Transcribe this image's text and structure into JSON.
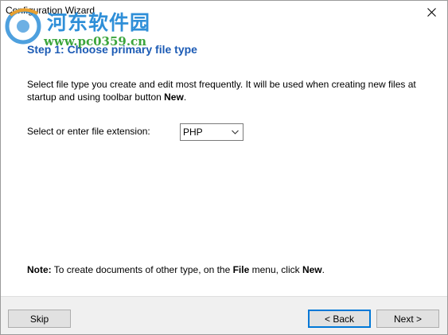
{
  "window": {
    "title": "Configuration Wizard"
  },
  "watermark": {
    "site_name": "河东软件园",
    "url": "www.pc0359.cn"
  },
  "step": {
    "title": "Step 1: Choose primary file type"
  },
  "description": {
    "text_before": "Select file type you create and edit most frequently. It will be used when creating new files at startup and using toolbar button ",
    "bold_word": "New",
    "text_after": "."
  },
  "extension": {
    "label": "Select or enter file extension:",
    "selected": "PHP"
  },
  "note": {
    "label": "Note:",
    "part1": " To create documents of other type, on the ",
    "menu": "File",
    "part2": " menu, click ",
    "command": "New",
    "part3": "."
  },
  "buttons": {
    "skip": "Skip",
    "back": "< Back",
    "next": "Next >"
  },
  "colors": {
    "step_title": "#1c5bb5",
    "default_button_border": "#0078d7",
    "footer_bg": "#f0f0f0"
  }
}
